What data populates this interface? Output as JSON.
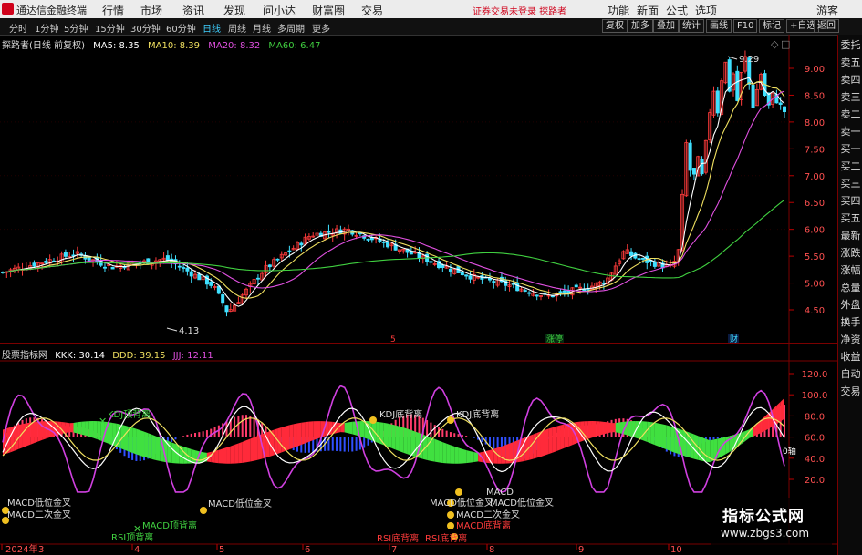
{
  "app_title": "通达信金融终端",
  "menu": [
    "行情",
    "市场",
    "资讯",
    "发现",
    "问小达",
    "财富圈",
    "交易"
  ],
  "trade_status": "证券交易未登录  探路者",
  "menu_right": [
    "功能",
    "新面",
    "公式",
    "选项",
    "游客"
  ],
  "periods": [
    "分时",
    "1分钟",
    "5分钟",
    "15分钟",
    "30分钟",
    "60分钟",
    "日线",
    "周线",
    "月线",
    "多周期",
    "更多"
  ],
  "selected_period": "日线",
  "toolbar_right": [
    "复权",
    "加多",
    "叠加",
    "统计",
    "画线",
    "F10",
    "标记",
    "+自选",
    "返回"
  ],
  "main_legend": {
    "name": "探路者(日线 前复权)",
    "ma5": "MA5: 8.35",
    "ma10": "MA10: 8.39",
    "ma20": "MA20: 8.32",
    "ma60": "MA60: 6.47"
  },
  "sub_legend": {
    "name": "股票指标网",
    "kkk": "KKK: 30.14",
    "ddd": "DDD: 39.15",
    "jjj": "JJJ: 12.11"
  },
  "price_axis": [
    "9.00",
    "8.50",
    "8.00",
    "7.50",
    "7.00",
    "6.50",
    "6.00",
    "5.50",
    "5.00",
    "4.50"
  ],
  "indicator_axis": [
    "120.0",
    "100.0",
    "80.0",
    "60.0",
    "40.0",
    "20.0"
  ],
  "annotations": {
    "high": "9.29",
    "low": "4.13",
    "zero_axis": "0轴"
  },
  "events": [
    "5",
    "涨停",
    "财"
  ],
  "signals": [
    {
      "text": "KDJ顶背离",
      "kind": "x"
    },
    {
      "text": "KDJ底背离",
      "kind": "dot"
    },
    {
      "text": "KDJ底背离",
      "kind": "dot"
    },
    {
      "text": "MACD低位金叉",
      "kind": "dot"
    },
    {
      "text": "MACD二次金叉",
      "kind": "dot"
    },
    {
      "text": "MACD低位金叉",
      "kind": "dot"
    },
    {
      "text": "RSI顶背离",
      "kind": "x"
    },
    {
      "text": "MACD顶背离",
      "kind": "x"
    },
    {
      "text": "MACD",
      "kind": "dot"
    },
    {
      "text": "MACD低位金叉",
      "kind": "dot"
    },
    {
      "text": "MACD二次金叉",
      "kind": "dot"
    },
    {
      "text": "MACD底背离",
      "kind": "dot"
    },
    {
      "text": "RSI底背离",
      "kind": "dot"
    },
    {
      "text": "RSI底背离",
      "kind": "dot"
    }
  ],
  "date_axis": [
    "2024年",
    "3",
    "4",
    "5",
    "6",
    "7",
    "8",
    "9",
    "10"
  ],
  "side_panel": [
    "委托",
    "卖五",
    "卖四",
    "卖三",
    "卖二",
    "卖一",
    "买一",
    "买二",
    "买三",
    "买四",
    "买五",
    "最新",
    "涨跌",
    "涨幅",
    "总量",
    "外盘",
    "换手",
    "净资",
    "收益",
    "自动",
    "交易"
  ],
  "watermark": {
    "title": "指标公式网",
    "url": "www.zbgs3.com"
  },
  "colors": {
    "up": "#ff3b3b",
    "down": "#3fe0ff",
    "ma5": "#ffffff",
    "ma10": "#f0e060",
    "ma20": "#e050e0",
    "ma60": "#40d040",
    "accent": "#d0021b"
  }
}
